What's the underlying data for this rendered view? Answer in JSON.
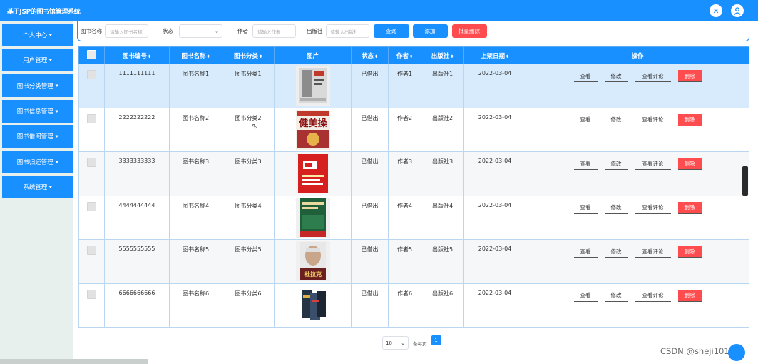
{
  "header": {
    "title": "基于JSP的图书馆管理系统",
    "icons": [
      "close-icon",
      "user-icon"
    ]
  },
  "sidebar": {
    "items": [
      {
        "label": "个人中心"
      },
      {
        "label": "用户管理"
      },
      {
        "label": "图书分类管理"
      },
      {
        "label": "图书信息管理"
      },
      {
        "label": "图书借阅管理"
      },
      {
        "label": "图书归还管理"
      },
      {
        "label": "系统管理"
      }
    ]
  },
  "filters": {
    "name_label": "图书名称",
    "name_placeholder": "请输入图书名称",
    "status_label": "状态",
    "status_value": "",
    "author_label": "作者",
    "author_placeholder": "请输入作者",
    "publisher_label": "出版社",
    "publisher_placeholder": "请输入出版社",
    "search_label": "查询",
    "add_label": "添加",
    "batch_delete_label": "批量删除"
  },
  "table": {
    "columns": [
      "图书编号",
      "图书名称",
      "图书分类",
      "图片",
      "状态",
      "作者",
      "出版社",
      "上架日期",
      "操作"
    ],
    "rows": [
      {
        "id": "1111111111",
        "name": "图书名称1",
        "category": "图书分类1",
        "status": "已借出",
        "author": "作者1",
        "publisher": "出版社1",
        "date": "2022-03-04"
      },
      {
        "id": "2222222222",
        "name": "图书名称2",
        "category": "图书分类2",
        "status": "已借出",
        "author": "作者2",
        "publisher": "出版社2",
        "date": "2022-03-04",
        "cover_title": "健美操"
      },
      {
        "id": "3333333333",
        "name": "图书名称3",
        "category": "图书分类3",
        "status": "已借出",
        "author": "作者3",
        "publisher": "出版社3",
        "date": "2022-03-04"
      },
      {
        "id": "4444444444",
        "name": "图书名称4",
        "category": "图书分类4",
        "status": "已借出",
        "author": "作者4",
        "publisher": "出版社4",
        "date": "2022-03-04"
      },
      {
        "id": "5555555555",
        "name": "图书名称5",
        "category": "图书分类5",
        "status": "已借出",
        "author": "作者5",
        "publisher": "出版社5",
        "date": "2022-03-04",
        "cover_title": "杜拉克"
      },
      {
        "id": "6666666666",
        "name": "图书名称6",
        "category": "图书分类6",
        "status": "已借出",
        "author": "作者6",
        "publisher": "出版社6",
        "date": "2022-03-04"
      }
    ],
    "actions": {
      "view": "查看",
      "edit": "修改",
      "comments": "查看评论",
      "delete": "删除"
    }
  },
  "pagination": {
    "page_size": "10",
    "per_page_label": "条每页",
    "current_page": "1"
  },
  "watermark": "CSDN @sheji1015",
  "colors": {
    "primary": "#1890ff",
    "danger": "#ff4d4f",
    "selected_row": "#d8ebfc"
  }
}
